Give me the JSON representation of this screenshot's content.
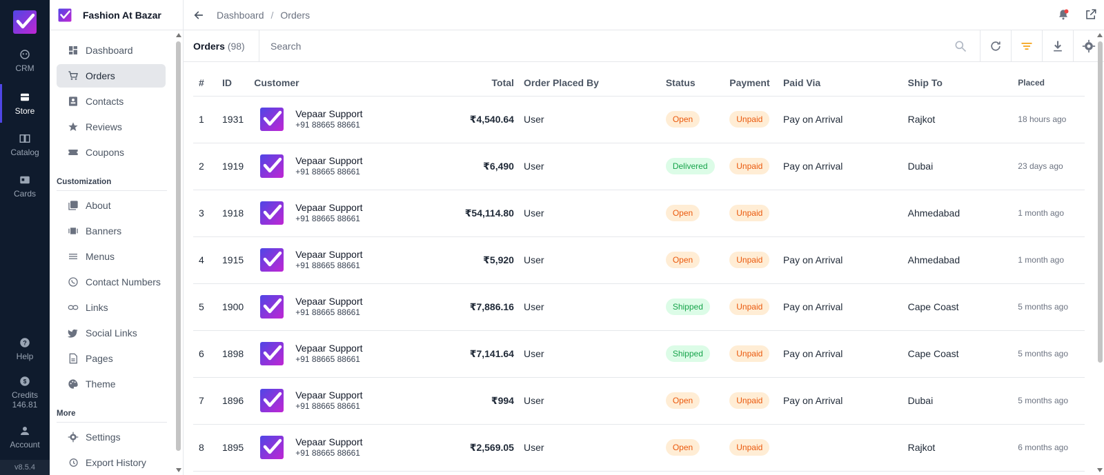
{
  "rail": {
    "items": [
      {
        "label": "CRM",
        "icon": "crm-icon"
      },
      {
        "label": "Store",
        "icon": "store-icon"
      },
      {
        "label": "Catalog",
        "icon": "catalog-icon"
      },
      {
        "label": "Cards",
        "icon": "cards-icon"
      }
    ],
    "bottom": [
      {
        "label": "Help",
        "icon": "help-icon"
      },
      {
        "label": "Credits",
        "icon": "credits-icon",
        "value": "146.81"
      },
      {
        "label": "Account",
        "icon": "account-icon"
      }
    ],
    "version": "v8.5.4"
  },
  "brand": {
    "name": "Fashion At Bazar"
  },
  "sidebar": {
    "main_items": [
      {
        "label": "Dashboard"
      },
      {
        "label": "Orders"
      },
      {
        "label": "Contacts"
      },
      {
        "label": "Reviews"
      },
      {
        "label": "Coupons"
      }
    ],
    "customization_title": "Customization",
    "customization_items": [
      {
        "label": "About"
      },
      {
        "label": "Banners"
      },
      {
        "label": "Menus"
      },
      {
        "label": "Contact Numbers"
      },
      {
        "label": "Links"
      },
      {
        "label": "Social Links"
      },
      {
        "label": "Pages"
      },
      {
        "label": "Theme"
      }
    ],
    "more_title": "More",
    "more_items": [
      {
        "label": "Settings"
      },
      {
        "label": "Export History"
      }
    ]
  },
  "breadcrumb": {
    "parent": "Dashboard",
    "separator": "/",
    "current": "Orders"
  },
  "toolbar": {
    "title": "Orders",
    "count": "(98)",
    "search_placeholder": "Search"
  },
  "table": {
    "headers": {
      "num": "#",
      "id": "ID",
      "customer": "Customer",
      "total": "Total",
      "placed_by": "Order Placed By",
      "status": "Status",
      "payment": "Payment",
      "paid_via": "Paid Via",
      "ship_to": "Ship To",
      "placed": "Placed"
    },
    "rows": [
      {
        "num": "1",
        "id": "1931",
        "name": "Vepaar Support",
        "phone": "+91 88665 88661",
        "total": "₹4,540.64",
        "placed_by": "User",
        "status": "Open",
        "payment": "Unpaid",
        "paid_via": "Pay on Arrival",
        "ship_to": "Rajkot",
        "placed": "18 hours ago"
      },
      {
        "num": "2",
        "id": "1919",
        "name": "Vepaar Support",
        "phone": "+91 88665 88661",
        "total": "₹6,490",
        "placed_by": "User",
        "status": "Delivered",
        "payment": "Unpaid",
        "paid_via": "Pay on Arrival",
        "ship_to": "Dubai",
        "placed": "23 days ago"
      },
      {
        "num": "3",
        "id": "1918",
        "name": "Vepaar Support",
        "phone": "+91 88665 88661",
        "total": "₹54,114.80",
        "placed_by": "User",
        "status": "Open",
        "payment": "Unpaid",
        "paid_via": "",
        "ship_to": "Ahmedabad",
        "placed": "1 month ago"
      },
      {
        "num": "4",
        "id": "1915",
        "name": "Vepaar Support",
        "phone": "+91 88665 88661",
        "total": "₹5,920",
        "placed_by": "User",
        "status": "Open",
        "payment": "Unpaid",
        "paid_via": "Pay on Arrival",
        "ship_to": "Ahmedabad",
        "placed": "1 month ago"
      },
      {
        "num": "5",
        "id": "1900",
        "name": "Vepaar Support",
        "phone": "+91 88665 88661",
        "total": "₹7,886.16",
        "placed_by": "User",
        "status": "Shipped",
        "payment": "Unpaid",
        "paid_via": "Pay on Arrival",
        "ship_to": "Cape Coast",
        "placed": "5 months ago"
      },
      {
        "num": "6",
        "id": "1898",
        "name": "Vepaar Support",
        "phone": "+91 88665 88661",
        "total": "₹7,141.64",
        "placed_by": "User",
        "status": "Shipped",
        "payment": "Unpaid",
        "paid_via": "Pay on Arrival",
        "ship_to": "Cape Coast",
        "placed": "5 months ago"
      },
      {
        "num": "7",
        "id": "1896",
        "name": "Vepaar Support",
        "phone": "+91 88665 88661",
        "total": "₹994",
        "placed_by": "User",
        "status": "Open",
        "payment": "Unpaid",
        "paid_via": "Pay on Arrival",
        "ship_to": "Dubai",
        "placed": "5 months ago"
      },
      {
        "num": "8",
        "id": "1895",
        "name": "Vepaar Support",
        "phone": "+91 88665 88661",
        "total": "₹2,569.05",
        "placed_by": "User",
        "status": "Open",
        "payment": "Unpaid",
        "paid_via": "",
        "ship_to": "Rajkot",
        "placed": "6 months ago"
      }
    ]
  },
  "colors": {
    "accent": "#4f46e5",
    "rail_bg": "#0f1b2d",
    "open": "#ea580c",
    "delivered": "#16a34a",
    "filter_active": "#f59e0b"
  }
}
